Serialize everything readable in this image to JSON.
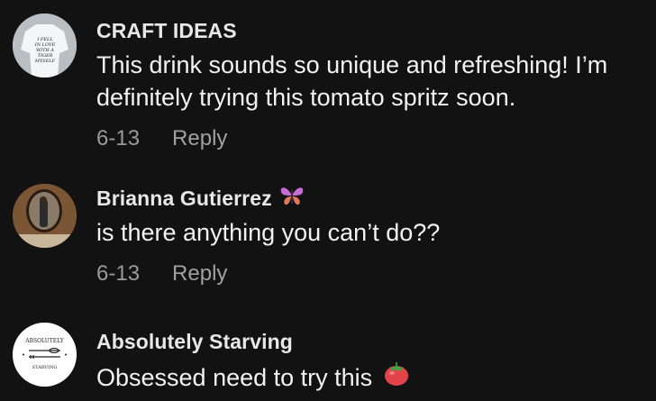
{
  "comments": [
    {
      "author": "CRAFT IDEAS",
      "avatar": "shirt-text-avatar",
      "text": "This drink sounds so unique and refreshing! I’m definitely trying this tomato spritz soon.",
      "date": "6-13",
      "reply_label": "Reply"
    },
    {
      "author": "Brianna Gutierrez",
      "author_badge": "butterfly-emoji",
      "avatar": "mirror-selfie-avatar",
      "text": "is there anything you can’t do??",
      "date": "6-13",
      "reply_label": "Reply"
    },
    {
      "author": "Absolutely Starving",
      "avatar": "absolutely-starving-logo",
      "avatar_text_top": "ABSOLUTELY",
      "avatar_text_bottom": "STARVING",
      "text": "Obsessed need to try this",
      "text_emoji": "tomato-emoji"
    }
  ],
  "colors": {
    "background": "#121212",
    "author": "#e8e8e8",
    "text": "#f2f2f2",
    "meta": "#9a9a9a"
  }
}
